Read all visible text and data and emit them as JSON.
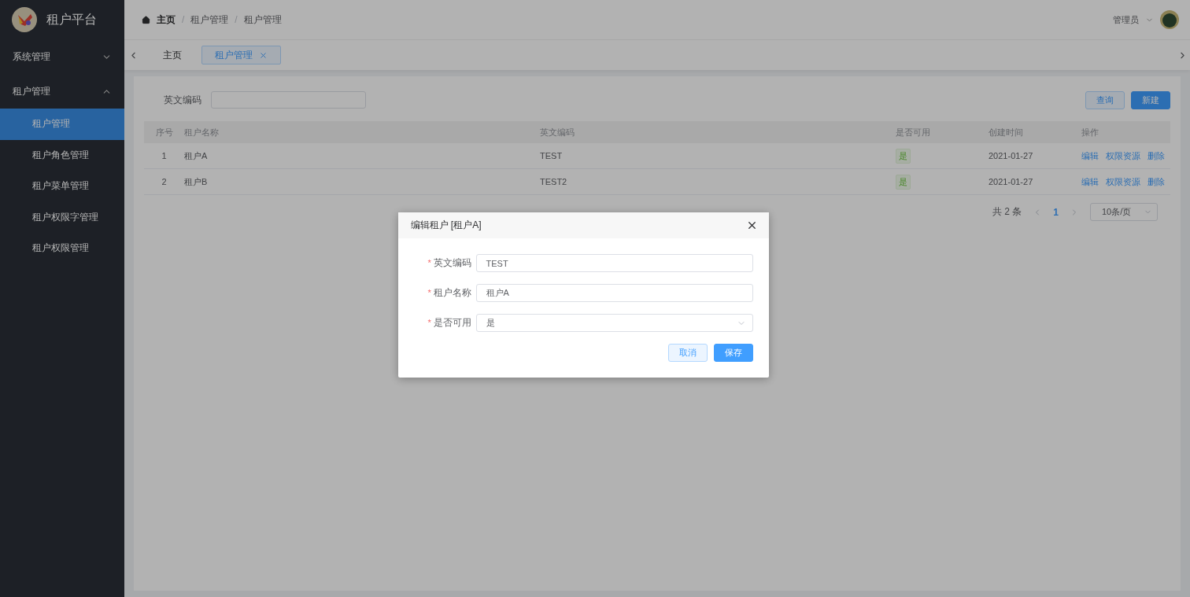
{
  "sidebar": {
    "title": "租户平台",
    "menu": [
      {
        "label": "系统管理",
        "expanded": false
      },
      {
        "label": "租户管理",
        "expanded": true,
        "children": [
          {
            "label": "租户管理",
            "selected": true
          },
          {
            "label": "租户角色管理",
            "selected": false
          },
          {
            "label": "租户菜单管理",
            "selected": false
          },
          {
            "label": "租户权限字管理",
            "selected": false
          },
          {
            "label": "租户权限管理",
            "selected": false
          }
        ]
      }
    ]
  },
  "header": {
    "breadcrumb": [
      "主页",
      "租户管理",
      "租户管理"
    ],
    "separator": "/",
    "user": "管理员"
  },
  "tabs": [
    {
      "label": "主页",
      "selected": false,
      "closable": false
    },
    {
      "label": "租户管理",
      "selected": true,
      "closable": true
    }
  ],
  "filter": {
    "label": "英文编码"
  },
  "toolbar_buttons": [
    {
      "label": "查询",
      "kind": "default"
    },
    {
      "label": "新建",
      "kind": "primary"
    }
  ],
  "table": {
    "columns": [
      "序号",
      "租户名称",
      "英文编码",
      "是否可用",
      "创建时间",
      "操作"
    ],
    "rows": [
      {
        "index": "1",
        "name": "租户A",
        "code": "TEST",
        "available": "是",
        "created": "2021-01-27",
        "actions": [
          "编辑",
          "权限资源",
          "删除"
        ]
      },
      {
        "index": "2",
        "name": "租户B",
        "code": "TEST2",
        "available": "是",
        "created": "2021-01-27",
        "actions": [
          "编辑",
          "权限资源",
          "删除"
        ]
      }
    ]
  },
  "pagination": {
    "total": "共 2 条",
    "pages": [
      {
        "label": "1",
        "selected": true
      }
    ],
    "page_size": "10条/页"
  },
  "dialog": {
    "title": "编辑租户 [租户A]",
    "required_mark": "*",
    "fields": [
      {
        "label": "英文编码",
        "required": true,
        "kind": "input",
        "value": "TEST"
      },
      {
        "label": "租户名称",
        "required": true,
        "kind": "input",
        "value": "租户A"
      },
      {
        "label": "是否可用",
        "required": true,
        "kind": "select",
        "value": "是"
      }
    ],
    "buttons": [
      {
        "label": "取消",
        "kind": "default"
      },
      {
        "label": "保存",
        "kind": "primary"
      }
    ]
  }
}
